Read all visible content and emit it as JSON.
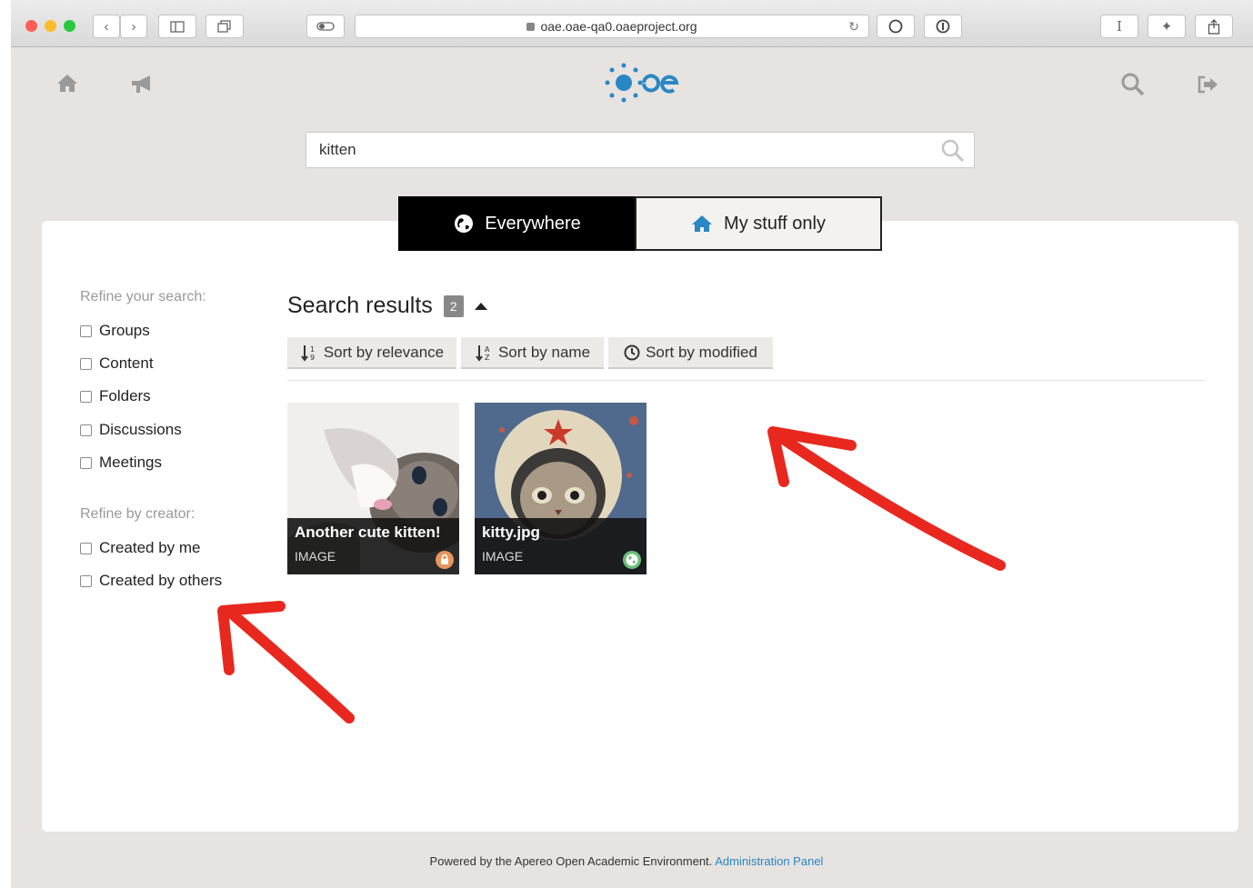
{
  "browser": {
    "url": "oae.oae-qa0.oaeproject.org"
  },
  "header": {
    "home_icon": "home-icon",
    "announce_icon": "megaphone-icon",
    "search_icon": "search-icon",
    "signout_icon": "sign-out-icon"
  },
  "search": {
    "value": "kitten"
  },
  "scope": {
    "everywhere": "Everywhere",
    "mine": "My stuff only"
  },
  "sidebar": {
    "refine_search_title": "Refine your search:",
    "types": [
      "Groups",
      "Content",
      "Folders",
      "Discussions",
      "Meetings"
    ],
    "refine_creator_title": "Refine by creator:",
    "creators": [
      "Created by me",
      "Created by others"
    ]
  },
  "results": {
    "title": "Search results",
    "count": "2",
    "sort": {
      "relevance": "Sort by relevance",
      "name": "Sort by name",
      "modified": "Sort by modified"
    },
    "items": [
      {
        "name": "Another cute kitten!",
        "type": "IMAGE",
        "visibility": "private"
      },
      {
        "name": "kitty.jpg",
        "type": "IMAGE",
        "visibility": "public"
      }
    ]
  },
  "footer": {
    "text": "Powered by the Apereo Open Academic Environment.",
    "link": "Administration Panel"
  },
  "colors": {
    "accent": "#2a87c5",
    "annotation": "#e8281e",
    "private_badge": "#e9955b",
    "public_badge": "#6bbf7a"
  }
}
